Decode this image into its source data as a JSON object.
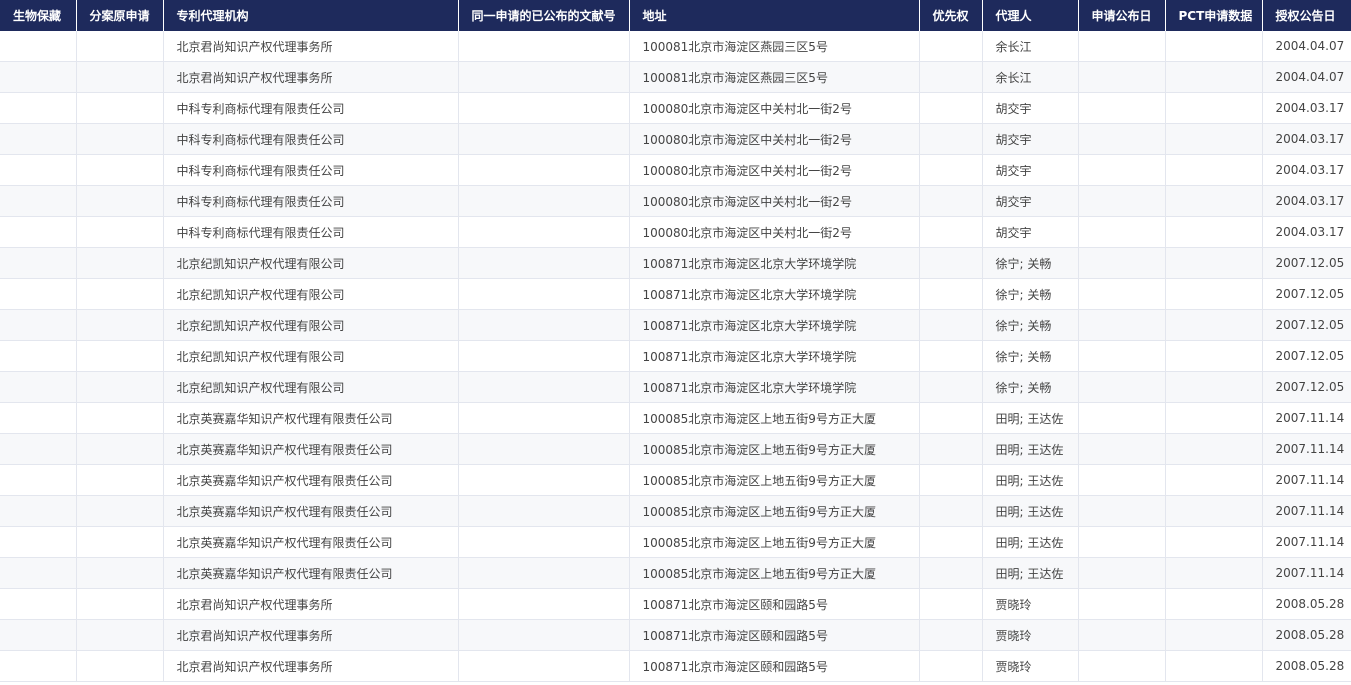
{
  "table": {
    "headers": [
      "生物保藏",
      "分案原申请",
      "专利代理机构",
      "同一申请的已公布的文献号",
      "地址",
      "优先权",
      "代理人",
      "申请公布日",
      "PCT申请数据",
      "授权公告日"
    ],
    "rows": [
      [
        "",
        "",
        "北京君尚知识产权代理事务所",
        "",
        "100081北京市海淀区燕园三区5号",
        "",
        "余长江",
        "",
        "",
        "2004.04.07"
      ],
      [
        "",
        "",
        "北京君尚知识产权代理事务所",
        "",
        "100081北京市海淀区燕园三区5号",
        "",
        "余长江",
        "",
        "",
        "2004.04.07"
      ],
      [
        "",
        "",
        "中科专利商标代理有限责任公司",
        "",
        "100080北京市海淀区中关村北一街2号",
        "",
        "胡交宇",
        "",
        "",
        "2004.03.17"
      ],
      [
        "",
        "",
        "中科专利商标代理有限责任公司",
        "",
        "100080北京市海淀区中关村北一街2号",
        "",
        "胡交宇",
        "",
        "",
        "2004.03.17"
      ],
      [
        "",
        "",
        "中科专利商标代理有限责任公司",
        "",
        "100080北京市海淀区中关村北一街2号",
        "",
        "胡交宇",
        "",
        "",
        "2004.03.17"
      ],
      [
        "",
        "",
        "中科专利商标代理有限责任公司",
        "",
        "100080北京市海淀区中关村北一街2号",
        "",
        "胡交宇",
        "",
        "",
        "2004.03.17"
      ],
      [
        "",
        "",
        "中科专利商标代理有限责任公司",
        "",
        "100080北京市海淀区中关村北一街2号",
        "",
        "胡交宇",
        "",
        "",
        "2004.03.17"
      ],
      [
        "",
        "",
        "北京纪凯知识产权代理有限公司",
        "",
        "100871北京市海淀区北京大学环境学院",
        "",
        "徐宁; 关畅",
        "",
        "",
        "2007.12.05"
      ],
      [
        "",
        "",
        "北京纪凯知识产权代理有限公司",
        "",
        "100871北京市海淀区北京大学环境学院",
        "",
        "徐宁; 关畅",
        "",
        "",
        "2007.12.05"
      ],
      [
        "",
        "",
        "北京纪凯知识产权代理有限公司",
        "",
        "100871北京市海淀区北京大学环境学院",
        "",
        "徐宁; 关畅",
        "",
        "",
        "2007.12.05"
      ],
      [
        "",
        "",
        "北京纪凯知识产权代理有限公司",
        "",
        "100871北京市海淀区北京大学环境学院",
        "",
        "徐宁; 关畅",
        "",
        "",
        "2007.12.05"
      ],
      [
        "",
        "",
        "北京纪凯知识产权代理有限公司",
        "",
        "100871北京市海淀区北京大学环境学院",
        "",
        "徐宁; 关畅",
        "",
        "",
        "2007.12.05"
      ],
      [
        "",
        "",
        "北京英赛嘉华知识产权代理有限责任公司",
        "",
        "100085北京市海淀区上地五街9号方正大厦",
        "",
        "田明; 王达佐",
        "",
        "",
        "2007.11.14"
      ],
      [
        "",
        "",
        "北京英赛嘉华知识产权代理有限责任公司",
        "",
        "100085北京市海淀区上地五街9号方正大厦",
        "",
        "田明; 王达佐",
        "",
        "",
        "2007.11.14"
      ],
      [
        "",
        "",
        "北京英赛嘉华知识产权代理有限责任公司",
        "",
        "100085北京市海淀区上地五街9号方正大厦",
        "",
        "田明; 王达佐",
        "",
        "",
        "2007.11.14"
      ],
      [
        "",
        "",
        "北京英赛嘉华知识产权代理有限责任公司",
        "",
        "100085北京市海淀区上地五街9号方正大厦",
        "",
        "田明; 王达佐",
        "",
        "",
        "2007.11.14"
      ],
      [
        "",
        "",
        "北京英赛嘉华知识产权代理有限责任公司",
        "",
        "100085北京市海淀区上地五街9号方正大厦",
        "",
        "田明; 王达佐",
        "",
        "",
        "2007.11.14"
      ],
      [
        "",
        "",
        "北京英赛嘉华知识产权代理有限责任公司",
        "",
        "100085北京市海淀区上地五街9号方正大厦",
        "",
        "田明; 王达佐",
        "",
        "",
        "2007.11.14"
      ],
      [
        "",
        "",
        "北京君尚知识产权代理事务所",
        "",
        "100871北京市海淀区颐和园路5号",
        "",
        "贾晓玲",
        "",
        "",
        "2008.05.28"
      ],
      [
        "",
        "",
        "北京君尚知识产权代理事务所",
        "",
        "100871北京市海淀区颐和园路5号",
        "",
        "贾晓玲",
        "",
        "",
        "2008.05.28"
      ],
      [
        "",
        "",
        "北京君尚知识产权代理事务所",
        "",
        "100871北京市海淀区颐和园路5号",
        "",
        "贾晓玲",
        "",
        "",
        "2008.05.28"
      ]
    ]
  },
  "colors": {
    "header_bg": "#1e2a5c",
    "header_text": "#ffffff",
    "row_alt_bg": "#f7f8fa",
    "border": "#e3e6ee",
    "cell_text": "#444444"
  }
}
